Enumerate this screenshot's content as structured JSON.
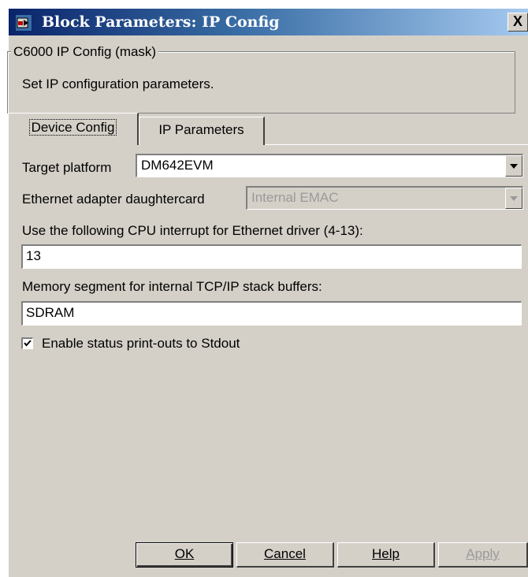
{
  "window": {
    "title": "Block Parameters: IP Config",
    "close_label": "X"
  },
  "group": {
    "title": "C6000 IP Config (mask)",
    "description": "Set IP configuration parameters."
  },
  "tabs": [
    {
      "label": "Device Config",
      "selected": true
    },
    {
      "label": "IP Parameters",
      "selected": false
    }
  ],
  "form": {
    "target_platform": {
      "label": "Target platform",
      "value": "DM642EVM"
    },
    "ethernet_adapter": {
      "label": "Ethernet adapter daughtercard",
      "value": "Internal EMAC",
      "enabled": false
    },
    "cpu_interrupt": {
      "label": "Use the following CPU interrupt for Ethernet driver (4-13):",
      "value": "13"
    },
    "memory_segment": {
      "label": "Memory segment for internal TCP/IP stack buffers:",
      "value": "SDRAM"
    },
    "status_printouts": {
      "label": "Enable status print-outs to Stdout",
      "checked": true
    }
  },
  "buttons": {
    "ok": "OK",
    "cancel": "Cancel",
    "help": "Help",
    "apply": "Apply"
  }
}
